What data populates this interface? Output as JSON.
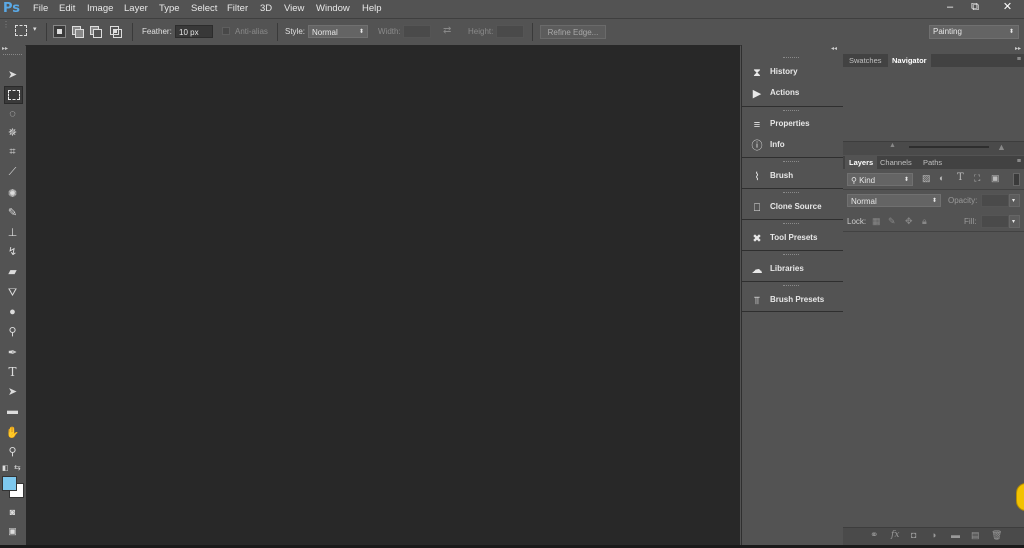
{
  "app": {
    "logo": "Ps"
  },
  "menu": [
    "File",
    "Edit",
    "Image",
    "Layer",
    "Type",
    "Select",
    "Filter",
    "3D",
    "View",
    "Window",
    "Help"
  ],
  "window_controls": {
    "minimize": "–",
    "restore": "⧉",
    "close": "✕"
  },
  "options": {
    "feather_label": "Feather:",
    "feather_value": "10 px",
    "antialias_label": "Anti-alias",
    "style_label": "Style:",
    "style_value": "Normal",
    "width_label": "Width:",
    "height_label": "Height:",
    "refine_edge": "Refine Edge...",
    "workspace": "Painting"
  },
  "dock": [
    {
      "label": "History",
      "icon": "history-icon",
      "glyph": "⧗"
    },
    {
      "label": "Actions",
      "icon": "actions-icon",
      "glyph": "▶"
    },
    {
      "label": "Properties",
      "icon": "properties-icon",
      "glyph": "≡"
    },
    {
      "label": "Info",
      "icon": "info-icon",
      "glyph": "ⓘ"
    },
    {
      "label": "Brush",
      "icon": "brush-icon",
      "glyph": "⌇"
    },
    {
      "label": "Clone Source",
      "icon": "clone-source-icon",
      "glyph": "⎕"
    },
    {
      "label": "Tool Presets",
      "icon": "tool-presets-icon",
      "glyph": "✖"
    },
    {
      "label": "Libraries",
      "icon": "libraries-icon",
      "glyph": "☁"
    },
    {
      "label": "Brush Presets",
      "icon": "brush-presets-icon",
      "glyph": "⫪"
    }
  ],
  "top_panel": {
    "tabs": [
      "Swatches",
      "Navigator"
    ],
    "active": "Navigator"
  },
  "layers_panel": {
    "tabs": [
      "Layers",
      "Channels",
      "Paths"
    ],
    "active": "Layers",
    "filter_kind": "Kind",
    "blend_mode": "Normal",
    "opacity_label": "Opacity:",
    "lock_label": "Lock:",
    "fill_label": "Fill:"
  },
  "colors": {
    "foreground": "#7ec8ee",
    "background": "#ffffff",
    "accent": "#5aa9e6"
  }
}
